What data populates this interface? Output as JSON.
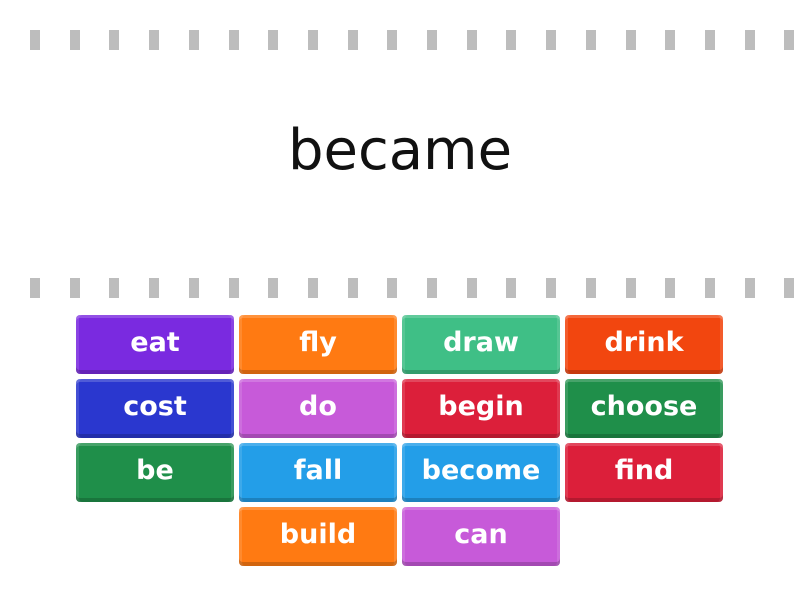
{
  "question": "became",
  "tiles": [
    {
      "label": "eat",
      "color": "#7a2ae0"
    },
    {
      "label": "fly",
      "color": "#ff7a12"
    },
    {
      "label": "draw",
      "color": "#3fbf86"
    },
    {
      "label": "drink",
      "color": "#f2460f"
    },
    {
      "label": "cost",
      "color": "#2a37cf"
    },
    {
      "label": "do",
      "color": "#c75ad9"
    },
    {
      "label": "begin",
      "color": "#dc1f3a"
    },
    {
      "label": "choose",
      "color": "#1f8f4a"
    },
    {
      "label": "be",
      "color": "#1f8f4a"
    },
    {
      "label": "fall",
      "color": "#239ee8"
    },
    {
      "label": "become",
      "color": "#239ee8"
    },
    {
      "label": "find",
      "color": "#dc1f3a"
    },
    {
      "label": "",
      "color": ""
    },
    {
      "label": "build",
      "color": "#ff7a12"
    },
    {
      "label": "can",
      "color": "#c75ad9"
    }
  ]
}
